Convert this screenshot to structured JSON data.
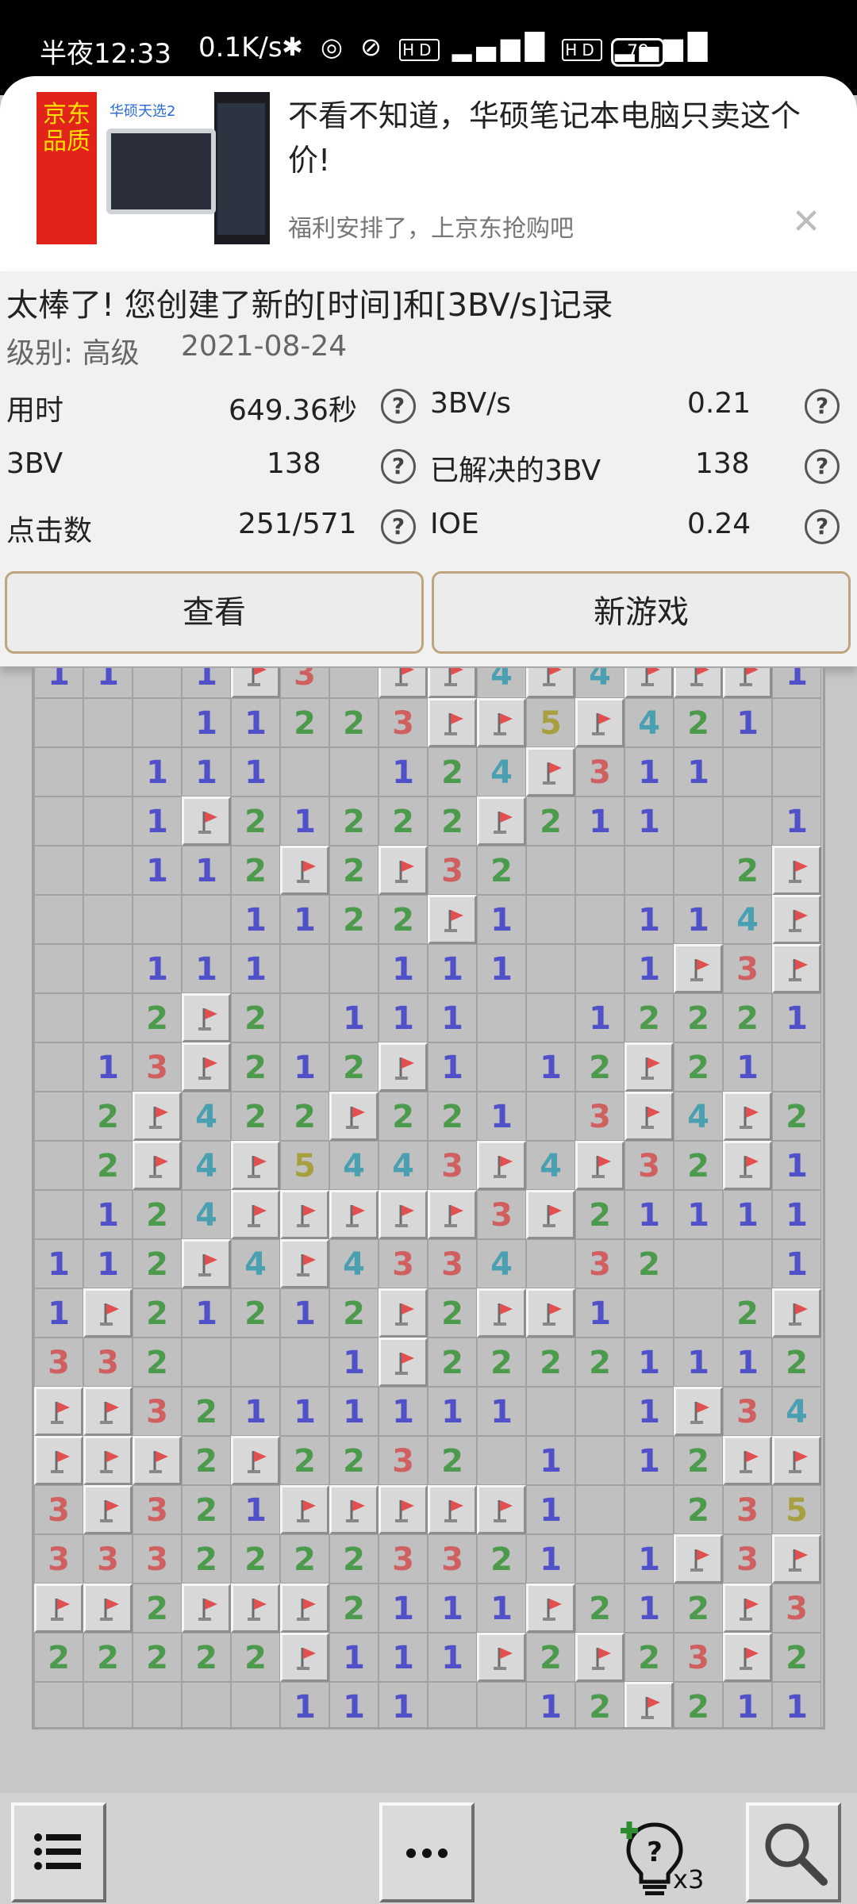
{
  "status_bar": {
    "time": "半夜12:33",
    "net_speed": "0.1K/s",
    "icons": [
      "bluetooth-icon",
      "vibrate-icon",
      "alarm-off-icon",
      "hd-icon",
      "5g-signal-icon",
      "hd-icon",
      "4g-signal-icon"
    ],
    "battery": "79"
  },
  "ad": {
    "title": "不看不知道，华硕笔记本电脑只卖这个价!",
    "subtitle": "福利安排了，上京东抢购吧",
    "image_side_text": "京东品质",
    "image_badge": "华硕天选2",
    "close_icon": "close-icon"
  },
  "result": {
    "headline": "太棒了! 您创建了新的[时间]和[3BV/s]记录",
    "level": "级别: 高级",
    "date": "2021-08-24",
    "stats_left": [
      {
        "label": "用时",
        "value": "649.36秒"
      },
      {
        "label": "3BV",
        "value": "138"
      },
      {
        "label": "点击数",
        "value": "251/571"
      }
    ],
    "stats_right": [
      {
        "label": "3BV/s",
        "value": "0.21"
      },
      {
        "label": "已解决的3BV",
        "value": "138"
      },
      {
        "label": "IOE",
        "value": "0.24"
      }
    ],
    "help_glyph": "?",
    "buttons": {
      "view": "查看",
      "new_game": "新游戏"
    }
  },
  "board": {
    "colors": {
      "1": "#5050c8",
      "2": "#4c9a4c",
      "3": "#d06060",
      "4": "#4aa0b0",
      "5": "#a8a040",
      "flag": "#e05050"
    },
    "rows": [
      "11.1F3.FF4F4FFF1",
      "...11223FF5F421",
      "..111..124F311.",
      "..1F21222F211..11",
      "..112F2F32....2F",
      "....1122F1..114F",
      "..111..111..1F3F",
      "..2F2.111..12221",
      ".13F212F1.12F21.",
      ".2F422F221.3F4F21",
      ".2F4F5443F4F32F1",
      ".124FFFFF3F21111",
      "112F4F4334 32..11",
      "1F21212F2FF1..2F",
      "332...1F22221112F",
      "FF32111111..1F343",
      "FFF2F2232.1.12FFF",
      "3F321FFFFF1..2353",
      "33322223321.1F3F",
      "FF2FFF2111F212F3",
      "22222F111F2F23F2",
      ".....111..12F211"
    ]
  },
  "toolbar": {
    "menu_icon": "menu-list-icon",
    "more_icon": "more-dots-icon",
    "hint_icon": "hint-bulb-icon",
    "hint_count": "x3",
    "zoom_icon": "magnifier-icon"
  }
}
